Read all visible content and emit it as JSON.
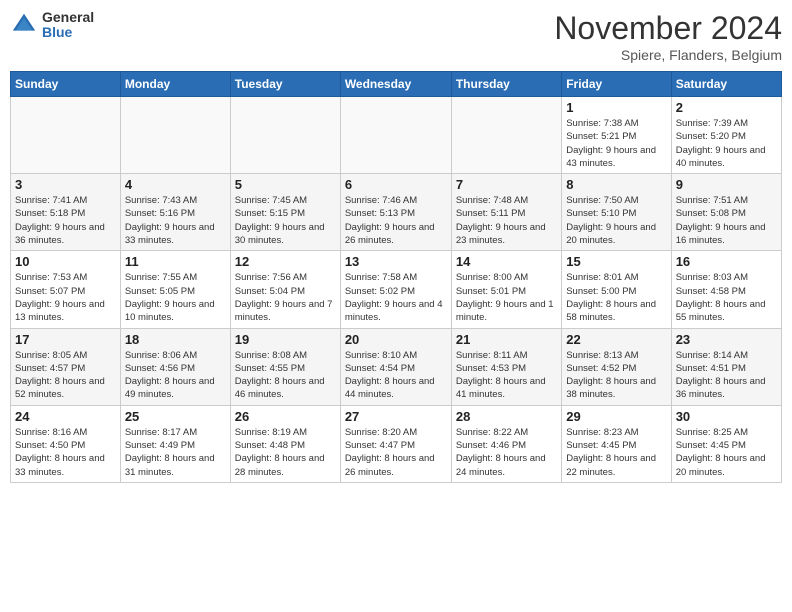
{
  "header": {
    "logo_general": "General",
    "logo_blue": "Blue",
    "month_title": "November 2024",
    "location": "Spiere, Flanders, Belgium"
  },
  "days_of_week": [
    "Sunday",
    "Monday",
    "Tuesday",
    "Wednesday",
    "Thursday",
    "Friday",
    "Saturday"
  ],
  "weeks": [
    {
      "days": [
        {
          "number": "",
          "info": ""
        },
        {
          "number": "",
          "info": ""
        },
        {
          "number": "",
          "info": ""
        },
        {
          "number": "",
          "info": ""
        },
        {
          "number": "",
          "info": ""
        },
        {
          "number": "1",
          "info": "Sunrise: 7:38 AM\nSunset: 5:21 PM\nDaylight: 9 hours and 43 minutes."
        },
        {
          "number": "2",
          "info": "Sunrise: 7:39 AM\nSunset: 5:20 PM\nDaylight: 9 hours and 40 minutes."
        }
      ]
    },
    {
      "days": [
        {
          "number": "3",
          "info": "Sunrise: 7:41 AM\nSunset: 5:18 PM\nDaylight: 9 hours and 36 minutes."
        },
        {
          "number": "4",
          "info": "Sunrise: 7:43 AM\nSunset: 5:16 PM\nDaylight: 9 hours and 33 minutes."
        },
        {
          "number": "5",
          "info": "Sunrise: 7:45 AM\nSunset: 5:15 PM\nDaylight: 9 hours and 30 minutes."
        },
        {
          "number": "6",
          "info": "Sunrise: 7:46 AM\nSunset: 5:13 PM\nDaylight: 9 hours and 26 minutes."
        },
        {
          "number": "7",
          "info": "Sunrise: 7:48 AM\nSunset: 5:11 PM\nDaylight: 9 hours and 23 minutes."
        },
        {
          "number": "8",
          "info": "Sunrise: 7:50 AM\nSunset: 5:10 PM\nDaylight: 9 hours and 20 minutes."
        },
        {
          "number": "9",
          "info": "Sunrise: 7:51 AM\nSunset: 5:08 PM\nDaylight: 9 hours and 16 minutes."
        }
      ]
    },
    {
      "days": [
        {
          "number": "10",
          "info": "Sunrise: 7:53 AM\nSunset: 5:07 PM\nDaylight: 9 hours and 13 minutes."
        },
        {
          "number": "11",
          "info": "Sunrise: 7:55 AM\nSunset: 5:05 PM\nDaylight: 9 hours and 10 minutes."
        },
        {
          "number": "12",
          "info": "Sunrise: 7:56 AM\nSunset: 5:04 PM\nDaylight: 9 hours and 7 minutes."
        },
        {
          "number": "13",
          "info": "Sunrise: 7:58 AM\nSunset: 5:02 PM\nDaylight: 9 hours and 4 minutes."
        },
        {
          "number": "14",
          "info": "Sunrise: 8:00 AM\nSunset: 5:01 PM\nDaylight: 9 hours and 1 minute."
        },
        {
          "number": "15",
          "info": "Sunrise: 8:01 AM\nSunset: 5:00 PM\nDaylight: 8 hours and 58 minutes."
        },
        {
          "number": "16",
          "info": "Sunrise: 8:03 AM\nSunset: 4:58 PM\nDaylight: 8 hours and 55 minutes."
        }
      ]
    },
    {
      "days": [
        {
          "number": "17",
          "info": "Sunrise: 8:05 AM\nSunset: 4:57 PM\nDaylight: 8 hours and 52 minutes."
        },
        {
          "number": "18",
          "info": "Sunrise: 8:06 AM\nSunset: 4:56 PM\nDaylight: 8 hours and 49 minutes."
        },
        {
          "number": "19",
          "info": "Sunrise: 8:08 AM\nSunset: 4:55 PM\nDaylight: 8 hours and 46 minutes."
        },
        {
          "number": "20",
          "info": "Sunrise: 8:10 AM\nSunset: 4:54 PM\nDaylight: 8 hours and 44 minutes."
        },
        {
          "number": "21",
          "info": "Sunrise: 8:11 AM\nSunset: 4:53 PM\nDaylight: 8 hours and 41 minutes."
        },
        {
          "number": "22",
          "info": "Sunrise: 8:13 AM\nSunset: 4:52 PM\nDaylight: 8 hours and 38 minutes."
        },
        {
          "number": "23",
          "info": "Sunrise: 8:14 AM\nSunset: 4:51 PM\nDaylight: 8 hours and 36 minutes."
        }
      ]
    },
    {
      "days": [
        {
          "number": "24",
          "info": "Sunrise: 8:16 AM\nSunset: 4:50 PM\nDaylight: 8 hours and 33 minutes."
        },
        {
          "number": "25",
          "info": "Sunrise: 8:17 AM\nSunset: 4:49 PM\nDaylight: 8 hours and 31 minutes."
        },
        {
          "number": "26",
          "info": "Sunrise: 8:19 AM\nSunset: 4:48 PM\nDaylight: 8 hours and 28 minutes."
        },
        {
          "number": "27",
          "info": "Sunrise: 8:20 AM\nSunset: 4:47 PM\nDaylight: 8 hours and 26 minutes."
        },
        {
          "number": "28",
          "info": "Sunrise: 8:22 AM\nSunset: 4:46 PM\nDaylight: 8 hours and 24 minutes."
        },
        {
          "number": "29",
          "info": "Sunrise: 8:23 AM\nSunset: 4:45 PM\nDaylight: 8 hours and 22 minutes."
        },
        {
          "number": "30",
          "info": "Sunrise: 8:25 AM\nSunset: 4:45 PM\nDaylight: 8 hours and 20 minutes."
        }
      ]
    }
  ]
}
